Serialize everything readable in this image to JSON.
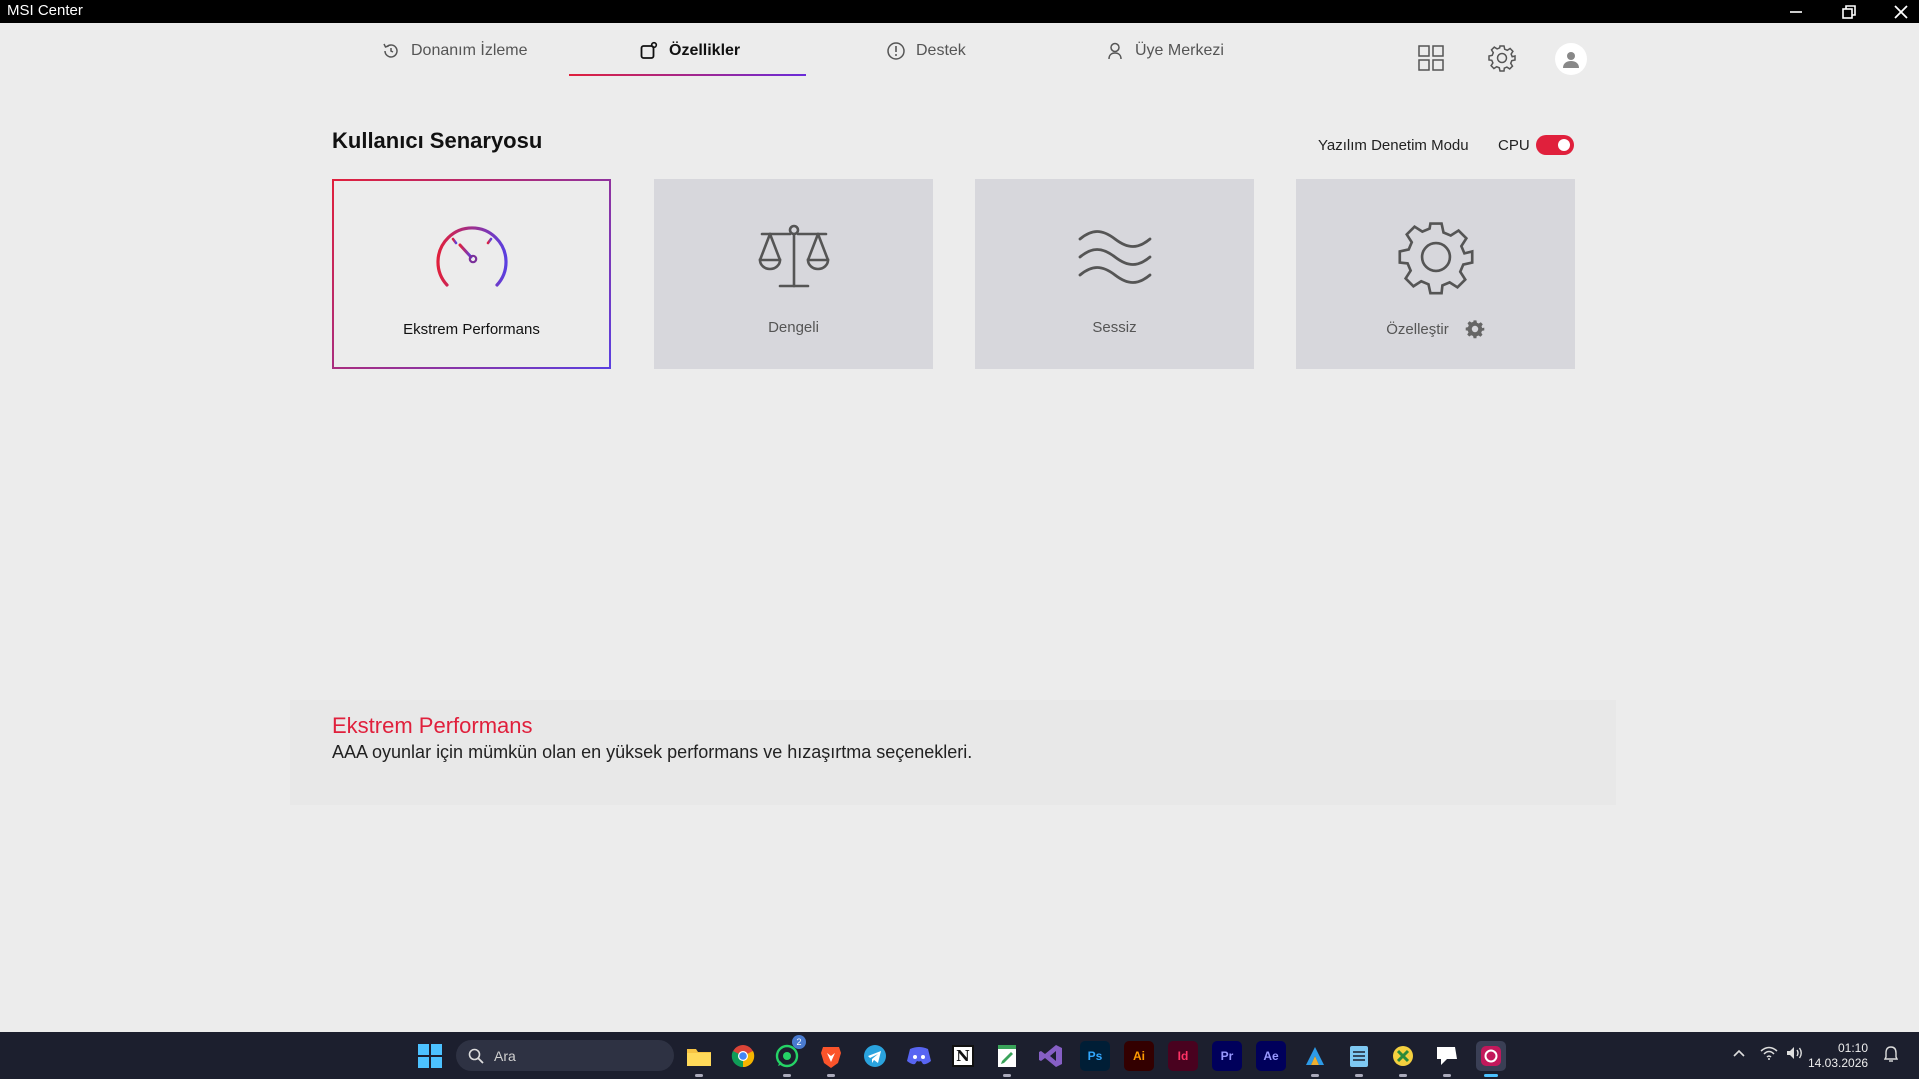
{
  "window": {
    "title": "MSI Center"
  },
  "nav": {
    "tabs": [
      {
        "label": "Donanım İzleme"
      },
      {
        "label": "Özellikler"
      },
      {
        "label": "Destek"
      },
      {
        "label": "Üye Merkezi"
      }
    ],
    "active_tab": "Özellikler"
  },
  "scenario": {
    "title": "Kullanıcı Senaryosu",
    "mode_label": "Yazılım Denetim Modu",
    "cpu_label": "CPU",
    "cpu_toggle_on": true,
    "cards": [
      {
        "label": "Ekstrem Performans",
        "icon": "speedometer-icon",
        "selected": true
      },
      {
        "label": "Dengeli",
        "icon": "balance-scale-icon",
        "selected": false
      },
      {
        "label": "Sessiz",
        "icon": "waves-icon",
        "selected": false
      },
      {
        "label": "Özelleştir",
        "icon": "gear-icon",
        "selected": false
      }
    ]
  },
  "description": {
    "title": "Ekstrem Performans",
    "text": "AAA oyunlar için mümkün olan en yüksek performans ve hızaşırtma seçenekleri."
  },
  "taskbar": {
    "search_placeholder": "Ara",
    "apps": [
      "file-explorer-icon",
      "chrome-icon",
      "whatsapp-icon",
      "brave-icon",
      "telegram-icon",
      "discord-icon",
      "notion-icon",
      "notepad-icon",
      "visual-studio-icon",
      "photoshop-icon",
      "illustrator-icon",
      "indesign-icon",
      "premiere-icon",
      "after-effects-icon",
      "app-a-icon",
      "notes-icon",
      "app-x-icon",
      "chat-icon",
      "msi-center-icon"
    ],
    "app_labels": {
      "ps": "Ps",
      "ai": "Ai",
      "id": "Id",
      "pr": "Pr",
      "ae": "Ae",
      "notion": "N"
    },
    "whatsapp_badge": "2",
    "time": "01:10",
    "date": "14.03.2026"
  },
  "colors": {
    "accent": "#e0203c",
    "accent2": "#5a3fe0",
    "card_bg": "#d7d7dc"
  }
}
